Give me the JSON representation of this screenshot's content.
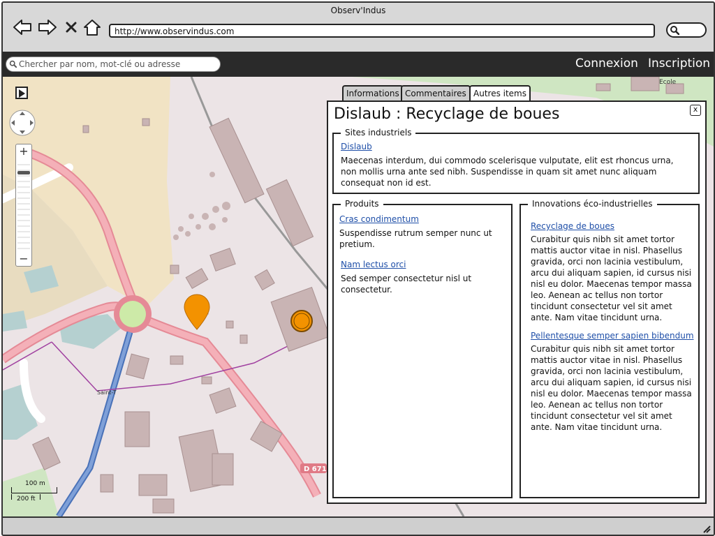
{
  "window": {
    "title": "Observ'Indus"
  },
  "browser": {
    "url": "http://www.observindus.com"
  },
  "appbar": {
    "search_placeholder": "Chercher par nom, mot-clé ou adresse",
    "login": "Connexion",
    "register": "Inscription"
  },
  "map": {
    "labels": {
      "school": "Ecole",
      "road": "D 671",
      "place": "Saint-T"
    },
    "scale": {
      "metric": "100 m",
      "imperial": "200 ft"
    },
    "zoom": {
      "plus": "+",
      "minus": "−"
    }
  },
  "tabs": [
    {
      "label": "Informations"
    },
    {
      "label": "Commentaires"
    },
    {
      "label": "Autres items"
    }
  ],
  "panel": {
    "title": "Dislaub : Recyclage de boues",
    "close": "x",
    "sites": {
      "legend": "Sites industriels",
      "link": "Dislaub",
      "text": "Maecenas interdum, dui commodo scelerisque vulputate, elit est rhoncus urna, non mollis urna ante sed nibh. Suspendisse in quam sit amet nunc aliquam consequat non id est."
    },
    "produits": {
      "legend": "Produits",
      "items": [
        {
          "link": "Cras condimentum",
          "text": "Suspendisse rutrum semper nunc ut pretium."
        },
        {
          "link": "Nam lectus orci",
          "text": "Sed semper consectetur nisl ut consectetur."
        }
      ]
    },
    "innovations": {
      "legend": "Innovations éco-industrielles",
      "items": [
        {
          "link": "Recyclage de boues",
          "text": "Curabitur quis nibh sit amet tortor mattis auctor vitae in nisl. Phasellus gravida, orci non lacinia vestibulum, arcu dui aliquam sapien, id cursus nisi nisl eu dolor. Maecenas tempor massa leo. Aenean ac tellus non tortor tincidunt consectetur vel sit amet ante. Nam vitae tincidunt urna."
        },
        {
          "link": "Pellentesque semper sapien bibendum",
          "text": "Curabitur quis nibh sit amet tortor mattis auctor vitae in nisl. Phasellus gravida, orci non lacinia vestibulum, arcu dui aliquam sapien, id cursus nisi nisl eu dolor. Maecenas tempor massa leo. Aenean ac tellus non tortor tincidunt consectetur vel sit amet ante. Nam vitae tincidunt urna."
        }
      ]
    }
  },
  "colors": {
    "marker": "#f39200",
    "link": "#1f4fa8",
    "appbar": "#2a2a2a"
  }
}
